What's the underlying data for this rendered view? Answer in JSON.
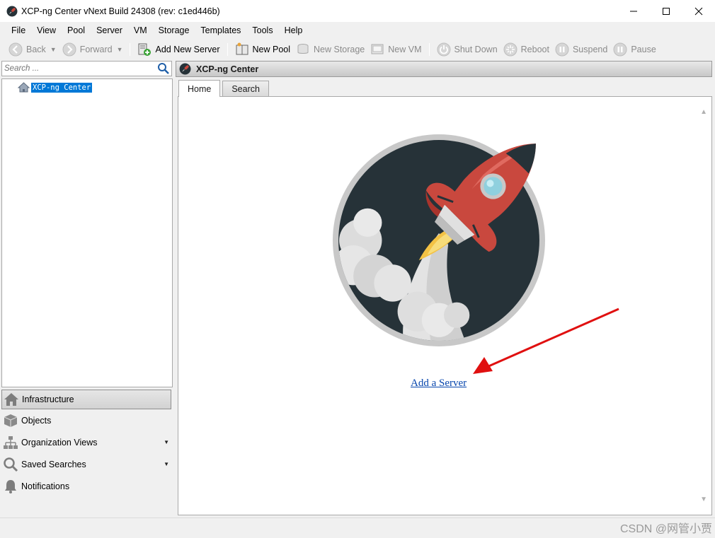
{
  "window": {
    "title": "XCP-ng Center vNext Build 24308 (rev: c1ed446b)",
    "controls": [
      "minimize",
      "maximize",
      "close"
    ]
  },
  "menu": [
    "File",
    "View",
    "Pool",
    "Server",
    "VM",
    "Storage",
    "Templates",
    "Tools",
    "Help"
  ],
  "toolbar": {
    "back": "Back",
    "forward": "Forward",
    "add_new_server": "Add New Server",
    "new_pool": "New Pool",
    "new_storage": "New Storage",
    "new_vm": "New VM",
    "shut_down": "Shut Down",
    "reboot": "Reboot",
    "suspend": "Suspend",
    "pause": "Pause"
  },
  "sidebar": {
    "search_placeholder": "Search ...",
    "tree_root": "XCP-ng Center",
    "nav": [
      {
        "label": "Infrastructure",
        "icon": "house-icon",
        "active": true
      },
      {
        "label": "Objects",
        "icon": "cube-icon"
      },
      {
        "label": "Organization Views",
        "icon": "org-chart-icon",
        "has_dropdown": true
      },
      {
        "label": "Saved Searches",
        "icon": "magnifier-icon",
        "has_dropdown": true
      },
      {
        "label": "Notifications",
        "icon": "bell-icon"
      }
    ]
  },
  "main": {
    "header_title": "XCP-ng Center",
    "tabs": [
      "Home",
      "Search"
    ],
    "active_tab": "Home",
    "link": "Add a Server"
  },
  "watermark": "CSDN @网管小贾",
  "colors": {
    "selection": "#0078d7",
    "link": "#0645ad",
    "rocket_body": "#c9483e",
    "badge_bg": "#263238",
    "arrow": "#e01010"
  }
}
